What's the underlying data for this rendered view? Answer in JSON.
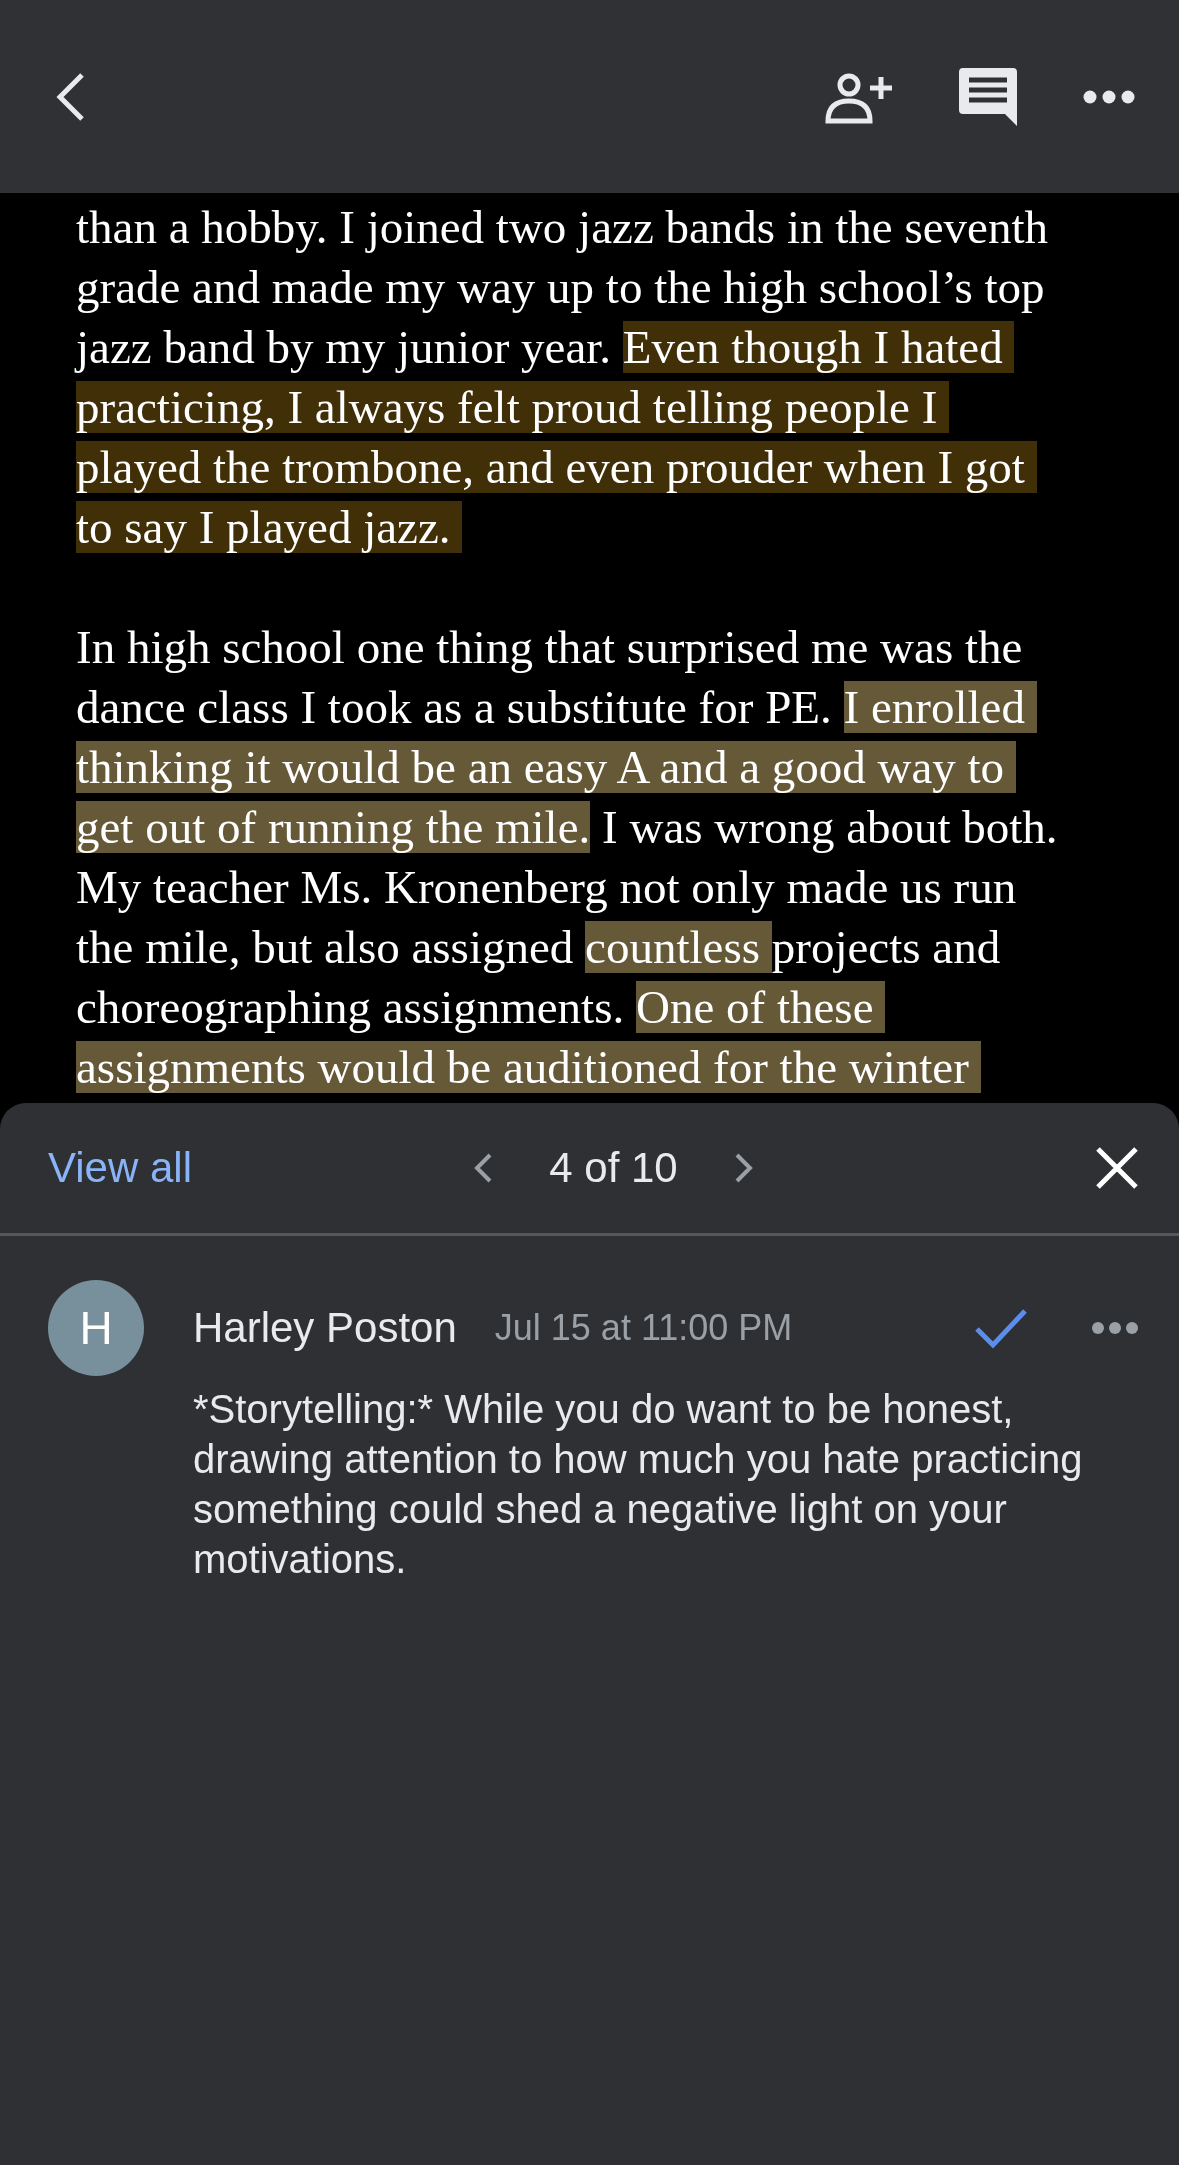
{
  "document": {
    "paragraphs": [
      {
        "lines": [
          [
            {
              "text": "than a hobby. I joined two jazz bands in the seventh",
              "highlighted": false,
              "selected": false
            }
          ],
          [
            {
              "text": "grade and made my way up to the high school’s top",
              "highlighted": false,
              "selected": false
            }
          ],
          [
            {
              "text": "jazz band by my junior year. ",
              "highlighted": false,
              "selected": false
            },
            {
              "text": "Even though I hated ",
              "highlighted": true,
              "selected": true
            }
          ],
          [
            {
              "text": "practicing, I always felt proud telling people I ",
              "highlighted": true,
              "selected": true
            }
          ],
          [
            {
              "text": "played the trombone, and even prouder when I got ",
              "highlighted": true,
              "selected": true
            }
          ],
          [
            {
              "text": "to say I played jazz. ",
              "highlighted": true,
              "selected": true
            }
          ]
        ]
      },
      {
        "lines": [
          [
            {
              "text": "In high school one thing that surprised me was the",
              "highlighted": false,
              "selected": false
            }
          ],
          [
            {
              "text": "dance class I took as a substitute for PE. ",
              "highlighted": false,
              "selected": false
            },
            {
              "text": "I enrolled ",
              "highlighted": true,
              "selected": false
            }
          ],
          [
            {
              "text": "thinking it would be an easy A and a good way to ",
              "highlighted": true,
              "selected": false
            }
          ],
          [
            {
              "text": "get out of running the mile.",
              "highlighted": true,
              "selected": false
            },
            {
              "text": " I was wrong about both.",
              "highlighted": false,
              "selected": false
            }
          ],
          [
            {
              "text": "My teacher Ms. Kronenberg not only made us run",
              "highlighted": false,
              "selected": false
            }
          ],
          [
            {
              "text": "the mile, but also assigned ",
              "highlighted": false,
              "selected": false
            },
            {
              "text": "countless ",
              "highlighted": true,
              "selected": false
            },
            {
              "text": "projects and",
              "highlighted": false,
              "selected": false
            }
          ],
          [
            {
              "text": "choreographing assignments. ",
              "highlighted": false,
              "selected": false
            },
            {
              "text": "One of these ",
              "highlighted": true,
              "selected": false
            }
          ],
          [
            {
              "text": "assignments would be auditioned for the winter ",
              "highlighted": true,
              "selected": false
            }
          ]
        ]
      }
    ]
  },
  "comment_panel": {
    "view_all": "View all",
    "counter": "4 of 10",
    "comment": {
      "avatar_letter": "H",
      "author": "Harley Poston",
      "time": "Jul 15 at 11:00 PM",
      "resolved": false,
      "body": "*Storytelling:* While you do want to be honest, drawing attention to how much you hate practicing something could shed a negative light on your motivations."
    }
  }
}
